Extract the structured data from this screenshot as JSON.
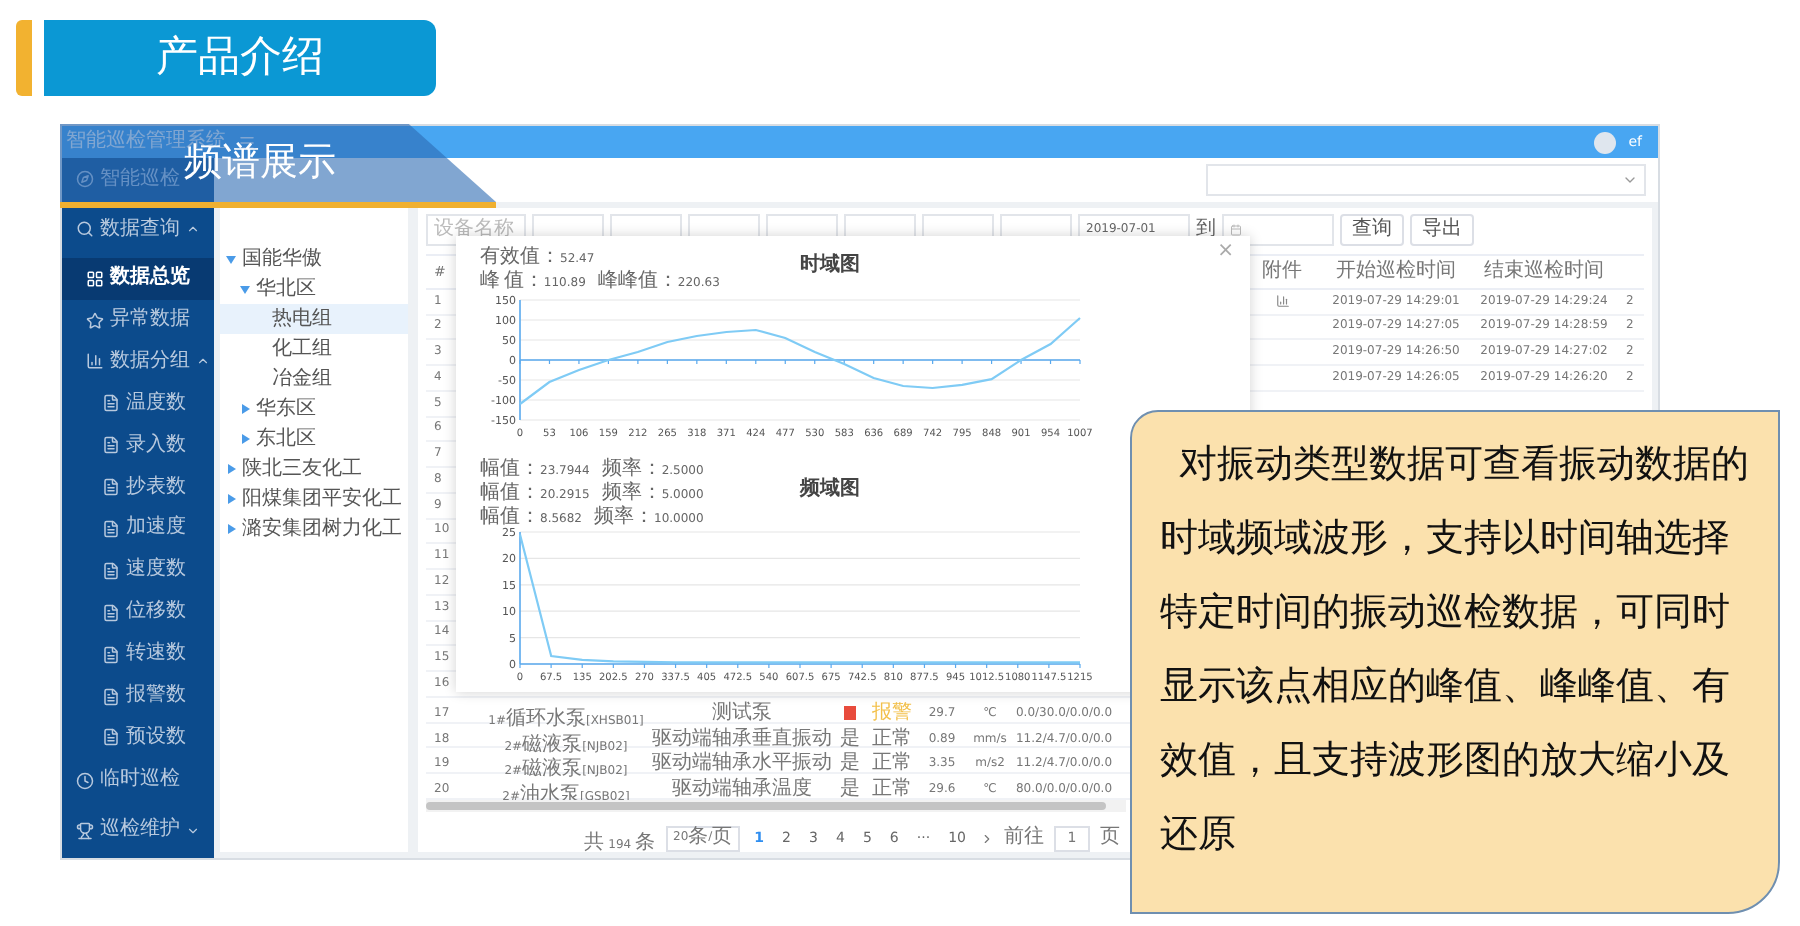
{
  "slide": {
    "title": "产品介绍",
    "section": "频谱展示"
  },
  "app": {
    "title": "智能巡检管理系统",
    "user": "ef"
  },
  "sidebar": {
    "items": [
      {
        "label": "智能巡检",
        "selected": false
      },
      {
        "label": "数据查询",
        "selected": false,
        "expanded": true,
        "children": [
          {
            "label": "数据总览",
            "selected": true
          },
          {
            "label": "异常数据",
            "selected": false
          },
          {
            "label": "数据分组",
            "selected": false,
            "expanded": true,
            "children": [
              {
                "label": "温度数",
                "selected": false
              },
              {
                "label": "录入数",
                "selected": false
              },
              {
                "label": "抄表数",
                "selected": false
              },
              {
                "label": "加速度",
                "selected": false
              },
              {
                "label": "速度数",
                "selected": false
              },
              {
                "label": "位移数",
                "selected": false
              },
              {
                "label": "转速数",
                "selected": false
              },
              {
                "label": "报警数",
                "selected": false
              },
              {
                "label": "预设数",
                "selected": false
              }
            ]
          }
        ]
      },
      {
        "label": "临时巡检",
        "selected": false
      },
      {
        "label": "巡检维护",
        "selected": false,
        "expanded": false
      }
    ]
  },
  "tree": {
    "items": [
      {
        "label": "国能华傲",
        "selected": false,
        "expanded": true,
        "children": [
          {
            "label": "华北区",
            "selected": false,
            "expanded": true,
            "children": [
              {
                "label": "热电组",
                "selected": true
              },
              {
                "label": "化工组",
                "selected": false
              },
              {
                "label": "冶金组",
                "selected": false
              }
            ]
          },
          {
            "label": "华东区",
            "selected": false,
            "expanded": false
          },
          {
            "label": "东北区",
            "selected": false,
            "expanded": false
          }
        ]
      },
      {
        "label": "陕北三友化工",
        "selected": false,
        "expanded": false
      },
      {
        "label": "阳煤集团平安化工",
        "selected": false,
        "expanded": false
      },
      {
        "label": "潞安集团树力化工",
        "selected": false,
        "expanded": false
      }
    ]
  },
  "filters": {
    "device_placeholder": "设备名称",
    "date_from": "2019-07-01",
    "to": "到",
    "buttons": [
      "查询",
      "导出"
    ]
  },
  "table": {
    "header": {
      "number": "#",
      "attachment": "附件",
      "start": "开始巡检时间",
      "end": "结束巡检时间"
    },
    "rows": [
      {
        "number": "1",
        "has_attachment": true,
        "start": "2019-07-29 14:29:01",
        "end": "2019-07-29 14:29:24",
        "column_13": "2"
      },
      {
        "number": "2",
        "has_attachment": false,
        "start": "2019-07-29 14:27:05",
        "end": "2019-07-29 14:28:59",
        "column_13": "2"
      },
      {
        "number": "3",
        "has_attachment": false,
        "start": "2019-07-29 14:26:50",
        "end": "2019-07-29 14:27:02",
        "column_13": "2"
      },
      {
        "number": "4",
        "has_attachment": false,
        "start": "2019-07-29 14:26:05",
        "end": "2019-07-29 14:26:20",
        "column_13": "2"
      },
      {
        "number": "5"
      },
      {
        "number": "6"
      },
      {
        "number": "7"
      },
      {
        "number": "8"
      },
      {
        "number": "9"
      },
      {
        "number": "10"
      },
      {
        "number": "11"
      },
      {
        "number": "12"
      },
      {
        "number": "13"
      },
      {
        "number": "14"
      },
      {
        "number": "15"
      },
      {
        "number": "16"
      },
      {
        "number": "17",
        "device": "1#循环水泵[XHSB01]",
        "point": "测试泵",
        "alarm": true,
        "status": "报警",
        "value": "29.7",
        "unit": "℃",
        "limits": "0.0/30.0/0.0/0.0"
      },
      {
        "number": "18",
        "device": "2#磁液泵[NJB02]",
        "point": "驱动端轴承垂直振动",
        "alarm": false,
        "flag": "是",
        "status": "正常",
        "value": "0.89",
        "unit": "mm/s",
        "limits": "11.2/4.7/0.0/0.0"
      },
      {
        "number": "19",
        "device": "2#磁液泵[NJB02]",
        "point": "驱动端轴承水平振动",
        "alarm": false,
        "flag": "是",
        "status": "正常",
        "value": "3.35",
        "unit": "m/s2",
        "limits": "11.2/4.7/0.0/0.0"
      },
      {
        "number": "20",
        "device": "2#油水泵[GSB02]",
        "point": "驱动端轴承温度",
        "alarm": false,
        "flag": "是",
        "status": "正常",
        "value": "29.6",
        "unit": "℃",
        "limits": "80.0/0.0/0.0/0.0"
      }
    ]
  },
  "pagination": {
    "total": "共 194 条",
    "page_size": "20条/页",
    "pages": [
      {
        "label": "1",
        "selected": true
      },
      {
        "label": "2",
        "selected": false
      },
      {
        "label": "3",
        "selected": false
      },
      {
        "label": "4",
        "selected": false
      },
      {
        "label": "5",
        "selected": false
      },
      {
        "label": "6",
        "selected": false
      },
      {
        "label": "···",
        "selected": false
      },
      {
        "label": "10",
        "selected": false
      }
    ],
    "goto": "前往",
    "goto_value": "1",
    "page_unit": "页"
  },
  "modal": {
    "close": "×",
    "time": {
      "stats": [
        [
          "有效值：52.47"
        ],
        [
          "峰 值：110.89",
          "峰峰值：220.63"
        ]
      ],
      "chart_data": {
        "type": "line",
        "title": "时域图",
        "grid": true,
        "ref_lines": [
          {
            "axis": "y",
            "value": 0
          }
        ],
        "x": [
          0,
          53,
          106,
          159,
          212,
          265,
          318,
          371,
          424,
          477,
          530,
          583,
          636,
          689,
          742,
          795,
          848,
          901,
          954,
          1007
        ],
        "xlim": [
          0,
          1007
        ],
        "ylim": [
          -150,
          150
        ],
        "yticks": [
          -150,
          -100,
          -50,
          0,
          50,
          100,
          150
        ],
        "xticks": [
          0,
          53,
          106,
          159,
          212,
          265,
          318,
          371,
          424,
          477,
          530,
          583,
          636,
          689,
          742,
          795,
          848,
          901,
          954,
          1007
        ],
        "series": [
          {
            "color": "#7fcbf5",
            "values": [
              -110,
              -55,
              -25,
              0,
              20,
              45,
              60,
              70,
              75,
              55,
              20,
              -10,
              -45,
              -65,
              -70,
              -62,
              -48,
              0,
              40,
              105
            ]
          }
        ]
      }
    },
    "frequency": {
      "stats": [
        [
          "幅值：23.7944",
          "频率：2.5000"
        ],
        [
          "幅值：20.2915",
          "频率：5.0000"
        ],
        [
          "幅值：8.5682",
          "频率：10.0000"
        ]
      ],
      "chart_data": {
        "type": "line",
        "title": "频域图",
        "grid": true,
        "x": [
          0,
          67.5,
          135,
          202.5,
          270,
          337.5,
          405,
          472.5,
          540,
          607.5,
          675,
          742.5,
          810,
          877.5,
          945,
          1012.5,
          1080,
          1147.5,
          1215
        ],
        "xlim": [
          0,
          1215
        ],
        "ylim": [
          0,
          25
        ],
        "yticks": [
          0,
          5,
          10,
          15,
          20,
          25
        ],
        "xticks": [
          0,
          67.5,
          135,
          202.5,
          270,
          337.5,
          405,
          472.5,
          540,
          607.5,
          675,
          742.5,
          810,
          877.5,
          945,
          1012.5,
          1080,
          1147.5,
          1215
        ],
        "series": [
          {
            "color": "#7fcbf5",
            "values": [
              24.5,
              1.5,
              0.8,
              0.5,
              0.4,
              0.3,
              0.3,
              0.3,
              0.3,
              0.3,
              0.3,
              0.3,
              0.3,
              0.3,
              0.3,
              0.3,
              0.3,
              0.3,
              0.3
            ]
          }
        ]
      }
    }
  },
  "callout": {
    "text": "对振动类型数据可查看振动数据的时域频域波形，支持以时间轴选择特定时间的振动巡检数据，可同时显示该点相应的峰值、峰峰值、有效值，且支持波形图的放大缩小及还原"
  }
}
